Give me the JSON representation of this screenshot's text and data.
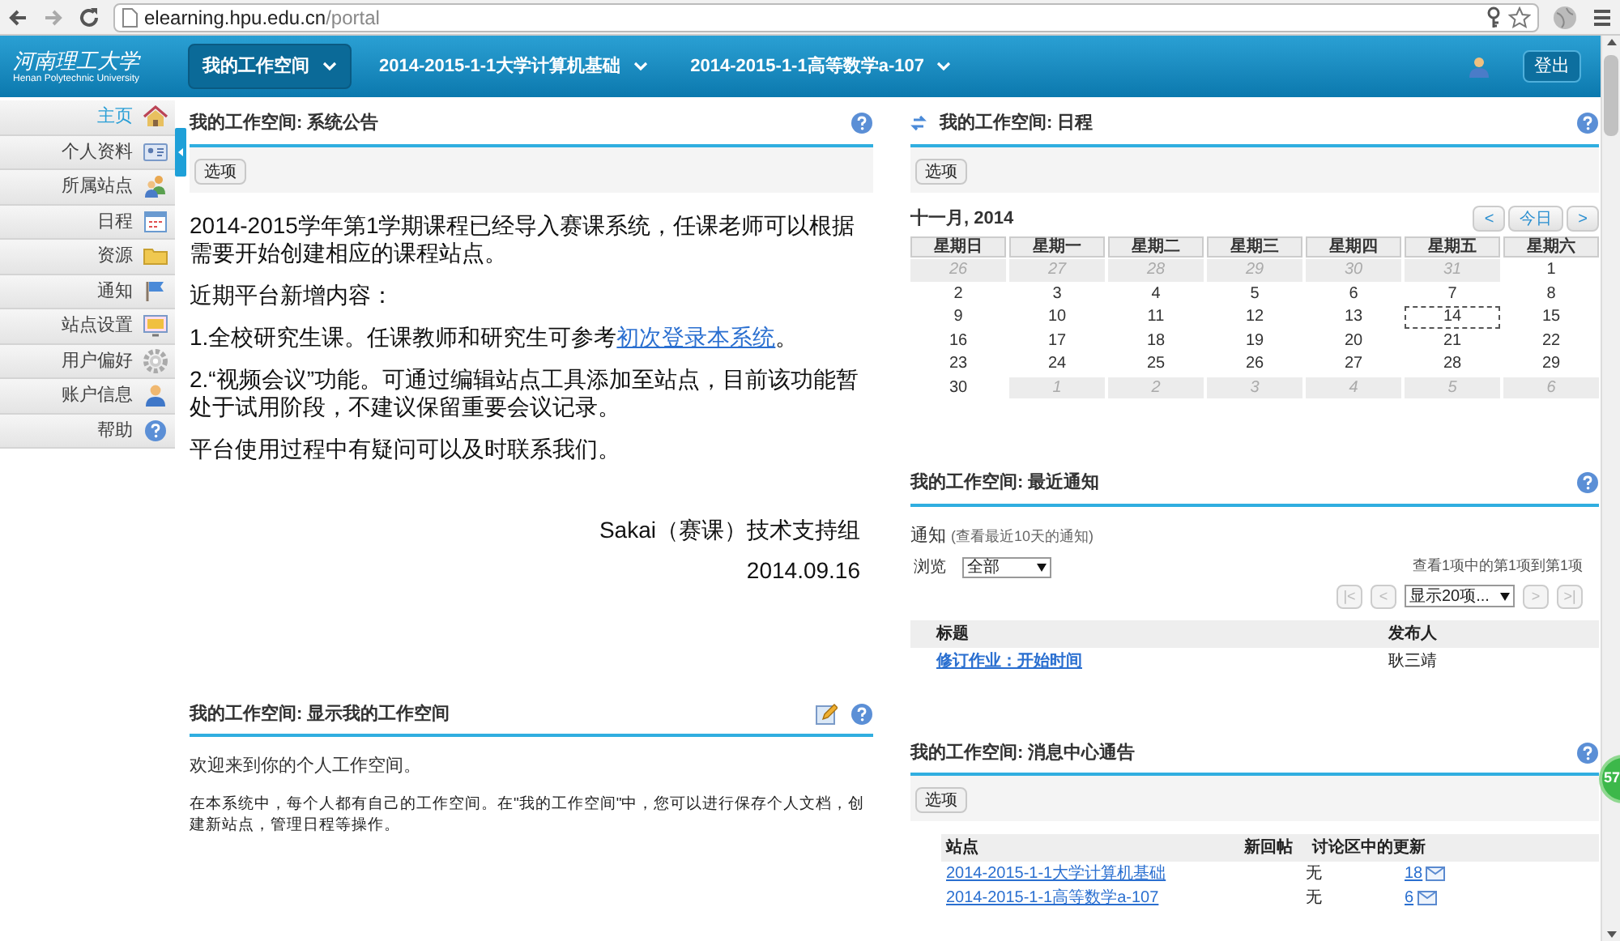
{
  "browser": {
    "address_host": "elearning.hpu.edu.cn",
    "address_path": "/portal"
  },
  "header": {
    "logo_text": "河南理工大学",
    "logo_subtitle": "Henan Polytechnic University",
    "logout": "登出",
    "tabs": [
      {
        "label": "我的工作空间",
        "selected": true
      },
      {
        "label": "2014-2015-1-1大学计算机基础",
        "selected": false
      },
      {
        "label": "2014-2015-1-1高等数学a-107",
        "selected": false
      }
    ]
  },
  "sidebar": {
    "items": [
      {
        "label": "主页",
        "selected": true
      },
      {
        "label": "个人资料",
        "selected": false
      },
      {
        "label": "所属站点",
        "selected": false
      },
      {
        "label": "日程",
        "selected": false
      },
      {
        "label": "资源",
        "selected": false
      },
      {
        "label": "通知",
        "selected": false
      },
      {
        "label": "站点设置",
        "selected": false
      },
      {
        "label": "用户偏好",
        "selected": false
      },
      {
        "label": "账户信息",
        "selected": false
      },
      {
        "label": "帮助",
        "selected": false
      }
    ]
  },
  "announcement": {
    "title": "我的工作空间: 系统公告",
    "options": "选项",
    "paragraphs": [
      {
        "text": "2014-2015学年第1学期课程已经导入赛课系统，任课老师可以根据需要开始创建相应的课程站点。"
      },
      {
        "text": "近期平台新增内容："
      },
      {
        "text": "1.全校研究生课。任课教师和研究生可参考",
        "link": "初次登录本系统",
        "after": "。"
      },
      {
        "text": "2.“视频会议”功能。可通过编辑站点工具添加至站点，目前该功能暂处于试用阶段，不建议保留重要会议记录。"
      },
      {
        "text": "平台使用过程中有疑问可以及时联系我们。"
      }
    ],
    "signature": "Sakai（赛课）技术支持组",
    "date": "2014.09.16"
  },
  "workspace": {
    "title": "我的工作空间: 显示我的工作空间",
    "welcome": "欢迎来到你的个人工作空间。",
    "description": "在本系统中，每个人都有自己的工作空间。在\"我的工作空间\"中，您可以进行保存个人文档，创建新站点，管理日程等操作。"
  },
  "calendar": {
    "title": "我的工作空间: 日程",
    "options": "选项",
    "month": "十一月, 2014",
    "prev": "<",
    "today_button": "今日",
    "next": ">",
    "weekdays": [
      "星期日",
      "星期一",
      "星期二",
      "星期三",
      "星期四",
      "星期五",
      "星期六"
    ],
    "weeks": [
      [
        {
          "day": "26",
          "outside": true,
          "today": false
        },
        {
          "day": "27",
          "outside": true,
          "today": false
        },
        {
          "day": "28",
          "outside": true,
          "today": false
        },
        {
          "day": "29",
          "outside": true,
          "today": false
        },
        {
          "day": "30",
          "outside": true,
          "today": false
        },
        {
          "day": "31",
          "outside": true,
          "today": false
        },
        {
          "day": "1",
          "outside": false,
          "today": false
        }
      ],
      [
        {
          "day": "2",
          "outside": false,
          "today": false
        },
        {
          "day": "3",
          "outside": false,
          "today": false
        },
        {
          "day": "4",
          "outside": false,
          "today": false
        },
        {
          "day": "5",
          "outside": false,
          "today": false
        },
        {
          "day": "6",
          "outside": false,
          "today": false
        },
        {
          "day": "7",
          "outside": false,
          "today": false
        },
        {
          "day": "8",
          "outside": false,
          "today": false
        }
      ],
      [
        {
          "day": "9",
          "outside": false,
          "today": false
        },
        {
          "day": "10",
          "outside": false,
          "today": false
        },
        {
          "day": "11",
          "outside": false,
          "today": false
        },
        {
          "day": "12",
          "outside": false,
          "today": false
        },
        {
          "day": "13",
          "outside": false,
          "today": false
        },
        {
          "day": "14",
          "outside": false,
          "today": true
        },
        {
          "day": "15",
          "outside": false,
          "today": false
        }
      ],
      [
        {
          "day": "16",
          "outside": false,
          "today": false
        },
        {
          "day": "17",
          "outside": false,
          "today": false
        },
        {
          "day": "18",
          "outside": false,
          "today": false
        },
        {
          "day": "19",
          "outside": false,
          "today": false
        },
        {
          "day": "20",
          "outside": false,
          "today": false
        },
        {
          "day": "21",
          "outside": false,
          "today": false
        },
        {
          "day": "22",
          "outside": false,
          "today": false
        }
      ],
      [
        {
          "day": "23",
          "outside": false,
          "today": false
        },
        {
          "day": "24",
          "outside": false,
          "today": false
        },
        {
          "day": "25",
          "outside": false,
          "today": false
        },
        {
          "day": "26",
          "outside": false,
          "today": false
        },
        {
          "day": "27",
          "outside": false,
          "today": false
        },
        {
          "day": "28",
          "outside": false,
          "today": false
        },
        {
          "day": "29",
          "outside": false,
          "today": false
        }
      ],
      [
        {
          "day": "30",
          "outside": false,
          "today": false
        },
        {
          "day": "1",
          "outside": true,
          "today": false
        },
        {
          "day": "2",
          "outside": true,
          "today": false
        },
        {
          "day": "3",
          "outside": true,
          "today": false
        },
        {
          "day": "4",
          "outside": true,
          "today": false
        },
        {
          "day": "5",
          "outside": true,
          "today": false
        },
        {
          "day": "6",
          "outside": true,
          "today": false
        }
      ]
    ]
  },
  "notices": {
    "title": "我的工作空间: 最近通知",
    "label": "通知",
    "hint": "(查看最近10天的通知)",
    "view_label": "浏览",
    "view_value": "全部",
    "paging": "查看1项中的第1项到第1项",
    "page_size": "显示20项...",
    "nav": [
      {
        "label": "|<",
        "disabled": true
      },
      {
        "label": "<",
        "disabled": true
      },
      {
        "label": ">",
        "disabled": true
      },
      {
        "label": ">|",
        "disabled": true
      }
    ],
    "columns": [
      "标题",
      "发布人"
    ],
    "rows": [
      {
        "title": "修订作业：开始时间",
        "author": "耿三靖"
      }
    ]
  },
  "messages": {
    "title": "我的工作空间: 消息中心通告",
    "options": "选项",
    "columns": [
      "站点",
      "新回帖",
      "讨论区中的更新"
    ],
    "rows": [
      {
        "site": "2014-2015-1-1大学计算机基础",
        "new_posts": "无",
        "updates": "18"
      },
      {
        "site": "2014-2015-1-1高等数学a-107",
        "new_posts": "无",
        "updates": "6"
      }
    ]
  },
  "floating_badge": "57"
}
